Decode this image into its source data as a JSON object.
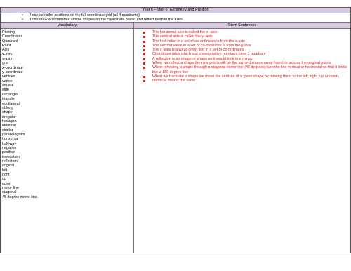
{
  "title": "Year 6 – Unit 6: Geometry and Position",
  "objectives": [
    "I can describe positions on the full coordinate grid (all 4 quadrants)",
    "I can draw and translate simple shapes on the coordinate plane, and reflect them in the axes."
  ],
  "headers": {
    "vocabulary": "Vocabulary",
    "stem_sentences": "Stem Sentences"
  },
  "vocabulary": [
    "Plotting",
    "Coordinates",
    "Quadrant",
    "Point",
    "Axis",
    "x-axis",
    "y-axis",
    "grid",
    "x-coordinate",
    "y-coordinate",
    "vertices",
    "vertex",
    "square",
    "side",
    "rectangle",
    "triangle",
    "equilateral",
    "oblong",
    "shape",
    "irregular",
    "hexagon",
    "identical",
    "similar",
    "parallelogram",
    "horizontal",
    "half-way",
    "negative",
    "positive",
    "translation",
    "reflection",
    "original",
    "left",
    "right",
    "up",
    "down",
    "mirror line",
    "diagonal",
    "45 degree mirror line."
  ],
  "stem_sentences": [
    "The horizontal axis is called the x -axis",
    "The vertical axis is called the y -axis",
    "The first value in a set of co-ordinates is from the x axis",
    "The second value in a set of co-ordinates is from the y axis",
    "The x -axis is always given first in a set of co-ordinates",
    "Coordinate grids which just show positive numbers have 1 quadrant",
    "A reflection is an image or shape as it would look in a mirror.",
    "When we reflect a shape the new points will be the same distance away from the axis as the original points",
    "When reflecting a shape through a diagonal mirror line (45 degrees) turn the line vertical or horizontal so that it looks like a 180 degree line",
    "When we translate a shape we move the vertices of a given shape by moving them to the left, right, up or down.",
    "Identical means the same"
  ],
  "colors": {
    "header_bg": "#d9c9e0",
    "stem_text": "#e0201b"
  }
}
